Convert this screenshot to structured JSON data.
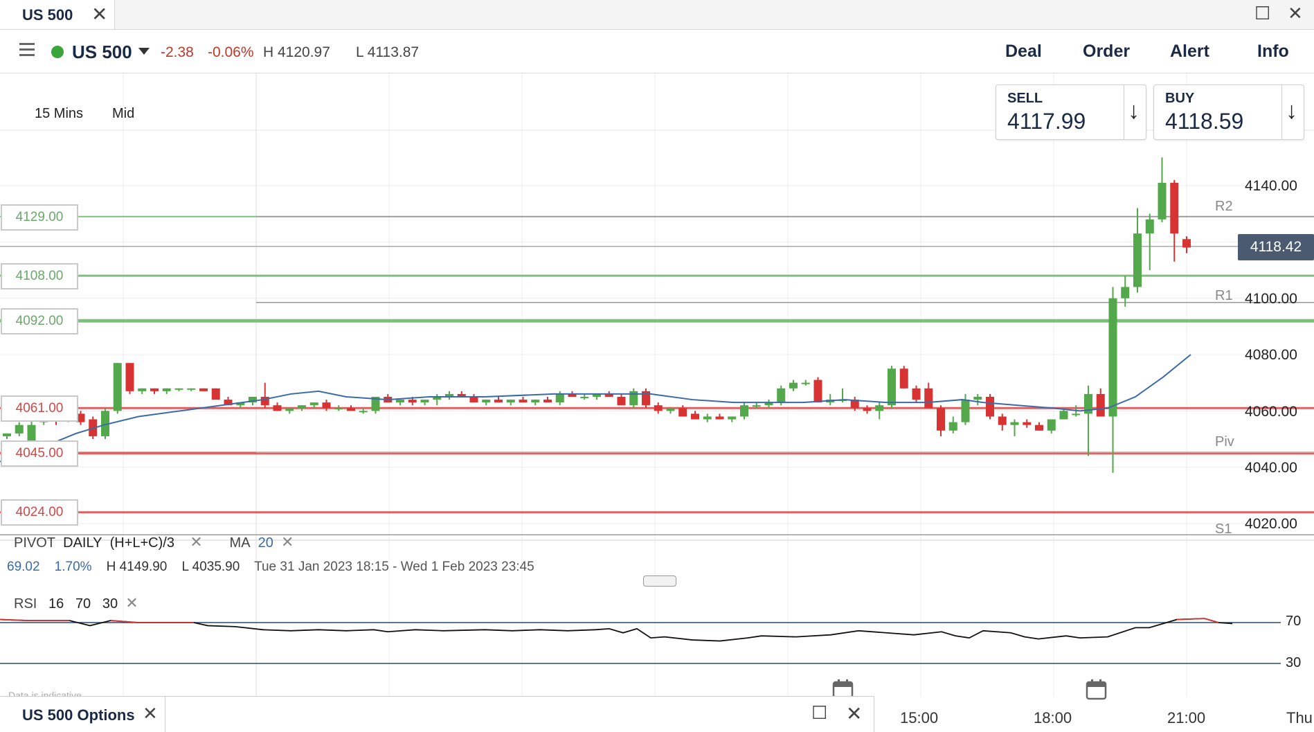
{
  "tab": {
    "title": "US 500"
  },
  "header": {
    "market": "US 500",
    "change": "-2.38",
    "change_pct": "-0.06%",
    "high": "H 4120.97",
    "low": "L 4113.87",
    "nav": [
      "Deal",
      "Order",
      "Alert",
      "Info"
    ]
  },
  "chart_settings": {
    "interval": "15 Mins",
    "price_type": "Mid"
  },
  "trade": {
    "sell_label": "SELL",
    "sell_price": "4117.99",
    "buy_label": "BUY",
    "buy_price": "4118.59"
  },
  "levels": [
    "4129.00",
    "4108.00",
    "4092.00",
    "4061.00",
    "4045.00",
    "4024.00"
  ],
  "pivot_labels": [
    "R2",
    "R1",
    "Piv",
    "S1"
  ],
  "last_price": "4118.42",
  "studies": {
    "pivot": "PIVOT",
    "pivot_period": "DAILY",
    "pivot_formula": "(H+L+C)/3",
    "ma": "MA",
    "ma_period": "20",
    "summary_change": "69.02",
    "summary_pct": "1.70%",
    "summary_high": "H 4149.90",
    "summary_low": "L 4035.90",
    "summary_range": "Tue 31 Jan 2023 18:15 - Wed 1 Feb 2023 23:45",
    "rsi": "RSI",
    "rsi_period": "16",
    "rsi_upper": "70",
    "rsi_lower": "30",
    "rsi_axis_upper": "70",
    "rsi_axis_lower": "30"
  },
  "footer_note": "Data is indicative",
  "bottom_tab": {
    "title": "US 500 Options"
  },
  "colors": {
    "up": "#52a84a",
    "down": "#d83333",
    "ma": "#3a6aa8",
    "resistance": "#7cc07c",
    "support": "#e06060"
  },
  "chart_data": {
    "type": "candlestick",
    "y_ticks": [
      "4140.00",
      "4100.00",
      "4080.00",
      "4060.00",
      "4040.00",
      "4020.00"
    ],
    "x_ticks": [
      "15:00",
      "18:00",
      "21:00",
      "Thu"
    ],
    "ylim": [
      4015,
      4150
    ],
    "resistance": [
      4129.0,
      4108.0,
      4092.0
    ],
    "support": [
      4061.0,
      4045.0,
      4024.0
    ],
    "pivot_levels": {
      "R2": 4129.0,
      "R1": 4098.5,
      "Piv": 4045.0,
      "S1": 4016.0
    },
    "last": 4118.42,
    "candles": [
      [
        4051,
        4052,
        4050,
        4052
      ],
      [
        4052,
        4056,
        4051,
        4055
      ],
      [
        4049,
        4057,
        4048,
        4055
      ],
      [
        4056,
        4059,
        4055,
        4058
      ],
      [
        4058,
        4058,
        4055,
        4057
      ],
      [
        4057,
        4060,
        4056,
        4059
      ],
      [
        4059,
        4060,
        4055,
        4056
      ],
      [
        4057,
        4058,
        4050,
        4051
      ],
      [
        4051,
        4061,
        4050,
        4060
      ],
      [
        4060,
        4077,
        4059,
        4077
      ],
      [
        4077,
        4077,
        4066,
        4067
      ],
      [
        4067,
        4068,
        4066,
        4068
      ],
      [
        4068,
        4068,
        4066,
        4067
      ],
      [
        4067,
        4068,
        4066,
        4068
      ],
      [
        4068,
        4068,
        4067,
        4068
      ],
      [
        4068,
        4068,
        4067,
        4068
      ],
      [
        4068,
        4068,
        4067,
        4067
      ],
      [
        4068,
        4068,
        4064,
        4064
      ],
      [
        4064,
        4065,
        4062,
        4062
      ],
      [
        4062,
        4063,
        4061,
        4063
      ],
      [
        4063,
        4065,
        4062,
        4065
      ],
      [
        4065,
        4070,
        4061,
        4062
      ],
      [
        4062,
        4063,
        4060,
        4060
      ],
      [
        4060,
        4061,
        4059,
        4061
      ],
      [
        4061,
        4062,
        4060,
        4062
      ],
      [
        4062,
        4063,
        4061,
        4063
      ],
      [
        4063,
        4064,
        4060,
        4061
      ],
      [
        4061,
        4062,
        4060,
        4061
      ],
      [
        4061,
        4062,
        4060,
        4060
      ],
      [
        4060,
        4061,
        4059,
        4060
      ],
      [
        4060,
        4065,
        4059,
        4065
      ],
      [
        4065,
        4066,
        4063,
        4063
      ],
      [
        4063,
        4064,
        4062,
        4064
      ],
      [
        4064,
        4065,
        4062,
        4063
      ],
      [
        4063,
        4064,
        4062,
        4064
      ],
      [
        4064,
        4066,
        4062,
        4065
      ],
      [
        4065,
        4067,
        4064,
        4066
      ],
      [
        4066,
        4067,
        4065,
        4065
      ],
      [
        4065,
        4066,
        4063,
        4063
      ],
      [
        4063,
        4064,
        4062,
        4064
      ],
      [
        4064,
        4065,
        4063,
        4063
      ],
      [
        4063,
        4064,
        4062,
        4064
      ],
      [
        4064,
        4065,
        4063,
        4063
      ],
      [
        4063,
        4064,
        4062,
        4064
      ],
      [
        4064,
        4065,
        4063,
        4063
      ],
      [
        4063,
        4067,
        4062,
        4066
      ],
      [
        4066,
        4067,
        4065,
        4065
      ],
      [
        4065,
        4066,
        4064,
        4065
      ],
      [
        4065,
        4066,
        4064,
        4066
      ],
      [
        4066,
        4067,
        4065,
        4065
      ],
      [
        4065,
        4066,
        4062,
        4062
      ],
      [
        4062,
        4068,
        4061,
        4067
      ],
      [
        4067,
        4068,
        4061,
        4062
      ],
      [
        4062,
        4063,
        4059,
        4060
      ],
      [
        4060,
        4061,
        4059,
        4061
      ],
      [
        4061,
        4062,
        4058,
        4058
      ],
      [
        4059,
        4060,
        4057,
        4057
      ],
      [
        4057,
        4059,
        4056,
        4058
      ],
      [
        4058,
        4059,
        4057,
        4057
      ],
      [
        4057,
        4058,
        4056,
        4058
      ],
      [
        4058,
        4063,
        4057,
        4062
      ],
      [
        4062,
        4063,
        4061,
        4062
      ],
      [
        4062,
        4064,
        4061,
        4063
      ],
      [
        4063,
        4069,
        4062,
        4068
      ],
      [
        4068,
        4071,
        4067,
        4070
      ],
      [
        4070,
        4071,
        4069,
        4070
      ],
      [
        4071,
        4072,
        4063,
        4063
      ],
      [
        4063,
        4066,
        4062,
        4064
      ],
      [
        4064,
        4068,
        4063,
        4064
      ],
      [
        4064,
        4065,
        4060,
        4061
      ],
      [
        4061,
        4062,
        4059,
        4060
      ],
      [
        4060,
        4063,
        4057,
        4062
      ],
      [
        4062,
        4076,
        4061,
        4075
      ],
      [
        4075,
        4076,
        4068,
        4068
      ],
      [
        4068,
        4069,
        4063,
        4064
      ],
      [
        4068,
        4070,
        4061,
        4061
      ],
      [
        4061,
        4062,
        4051,
        4053
      ],
      [
        4053,
        4058,
        4052,
        4056
      ],
      [
        4056,
        4066,
        4055,
        4064
      ],
      [
        4064,
        4066,
        4062,
        4065
      ],
      [
        4065,
        4066,
        4057,
        4058
      ],
      [
        4058,
        4059,
        4053,
        4055
      ],
      [
        4055,
        4057,
        4051,
        4056
      ],
      [
        4056,
        4057,
        4054,
        4055
      ],
      [
        4055,
        4056,
        4053,
        4053
      ],
      [
        4053,
        4057,
        4052,
        4057
      ],
      [
        4057,
        4061,
        4057,
        4060
      ],
      [
        4059,
        4062,
        4058,
        4059
      ],
      [
        4059,
        4069,
        4044,
        4066
      ],
      [
        4066,
        4068,
        4058,
        4058
      ],
      [
        4058,
        4104,
        4038,
        4100
      ],
      [
        4100,
        4108,
        4097,
        4104
      ],
      [
        4104,
        4132,
        4102,
        4123
      ],
      [
        4123,
        4130,
        4110,
        4128
      ],
      [
        4128,
        4150,
        4127,
        4141
      ],
      [
        4141,
        4142,
        4113,
        4123
      ],
      [
        4121,
        4122,
        4116,
        4118
      ]
    ],
    "ma20": [
      [
        0,
        4042
      ],
      [
        60,
        4047
      ],
      [
        110,
        4052
      ],
      [
        150,
        4055
      ],
      [
        200,
        4058
      ],
      [
        260,
        4060
      ],
      [
        320,
        4062
      ],
      [
        380,
        4064
      ],
      [
        420,
        4066
      ],
      [
        460,
        4067
      ],
      [
        500,
        4065
      ],
      [
        560,
        4064
      ],
      [
        620,
        4065
      ],
      [
        700,
        4065
      ],
      [
        800,
        4066
      ],
      [
        860,
        4066
      ],
      [
        940,
        4066
      ],
      [
        1000,
        4064
      ],
      [
        1060,
        4063
      ],
      [
        1100,
        4063
      ],
      [
        1160,
        4063
      ],
      [
        1220,
        4064
      ],
      [
        1280,
        4063
      ],
      [
        1340,
        4063
      ],
      [
        1390,
        4064
      ],
      [
        1420,
        4063
      ],
      [
        1470,
        4062
      ],
      [
        1520,
        4061
      ],
      [
        1560,
        4060
      ],
      [
        1600,
        4061
      ],
      [
        1640,
        4065
      ],
      [
        1680,
        4072
      ],
      [
        1720,
        4080
      ]
    ],
    "rsi": [
      [
        0,
        73
      ],
      [
        40,
        72
      ],
      [
        100,
        72
      ],
      [
        130,
        67
      ],
      [
        160,
        72
      ],
      [
        200,
        70
      ],
      [
        280,
        70
      ],
      [
        300,
        67
      ],
      [
        340,
        66
      ],
      [
        380,
        63
      ],
      [
        420,
        62
      ],
      [
        460,
        63
      ],
      [
        500,
        62
      ],
      [
        540,
        63
      ],
      [
        560,
        61
      ],
      [
        600,
        63
      ],
      [
        640,
        62
      ],
      [
        700,
        63
      ],
      [
        740,
        62
      ],
      [
        780,
        63
      ],
      [
        820,
        62
      ],
      [
        860,
        63
      ],
      [
        880,
        64
      ],
      [
        900,
        60
      ],
      [
        920,
        64
      ],
      [
        940,
        55
      ],
      [
        960,
        56
      ],
      [
        1000,
        53
      ],
      [
        1040,
        52
      ],
      [
        1080,
        55
      ],
      [
        1100,
        57
      ],
      [
        1150,
        56
      ],
      [
        1200,
        58
      ],
      [
        1240,
        62
      ],
      [
        1280,
        60
      ],
      [
        1320,
        58
      ],
      [
        1360,
        61
      ],
      [
        1380,
        57
      ],
      [
        1400,
        55
      ],
      [
        1420,
        62
      ],
      [
        1460,
        60
      ],
      [
        1480,
        56
      ],
      [
        1500,
        54
      ],
      [
        1540,
        57
      ],
      [
        1560,
        55
      ],
      [
        1600,
        56
      ],
      [
        1640,
        65
      ],
      [
        1660,
        65
      ],
      [
        1700,
        73
      ],
      [
        1740,
        74
      ],
      [
        1760,
        70
      ],
      [
        1780,
        69
      ]
    ]
  }
}
